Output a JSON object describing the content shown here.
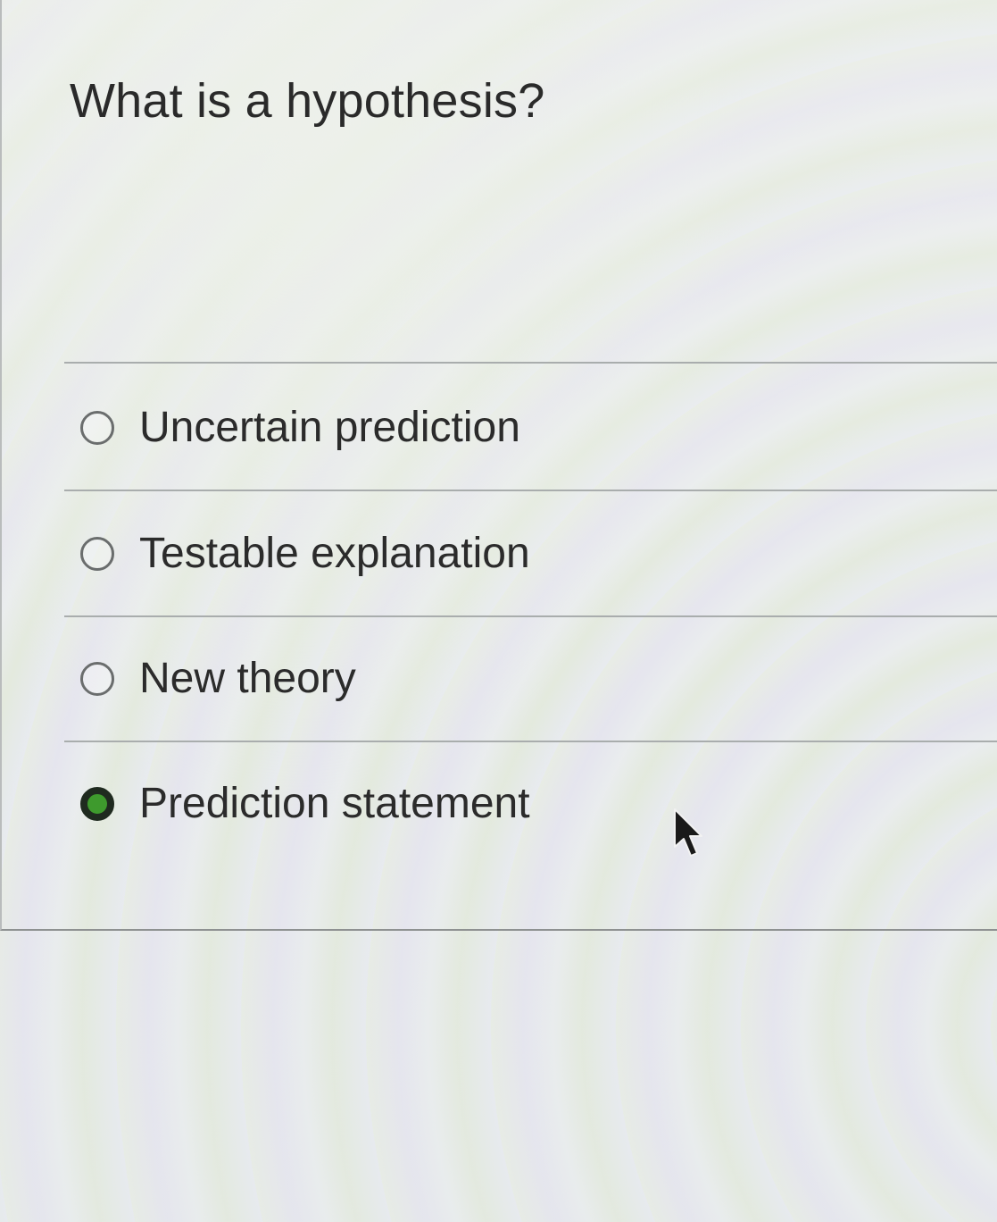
{
  "question": {
    "text": "What is a hypothesis?"
  },
  "options": [
    {
      "label": "Uncertain prediction",
      "selected": false
    },
    {
      "label": "Testable explanation",
      "selected": false
    },
    {
      "label": "New theory",
      "selected": false
    },
    {
      "label": "Prediction statement",
      "selected": true
    }
  ],
  "colors": {
    "selected_fill": "#3e9a2d",
    "selected_ring": "#1f2a1f",
    "unselected_ring": "#6a6d6d"
  },
  "icons": {
    "cursor": "mouse-pointer-icon"
  }
}
